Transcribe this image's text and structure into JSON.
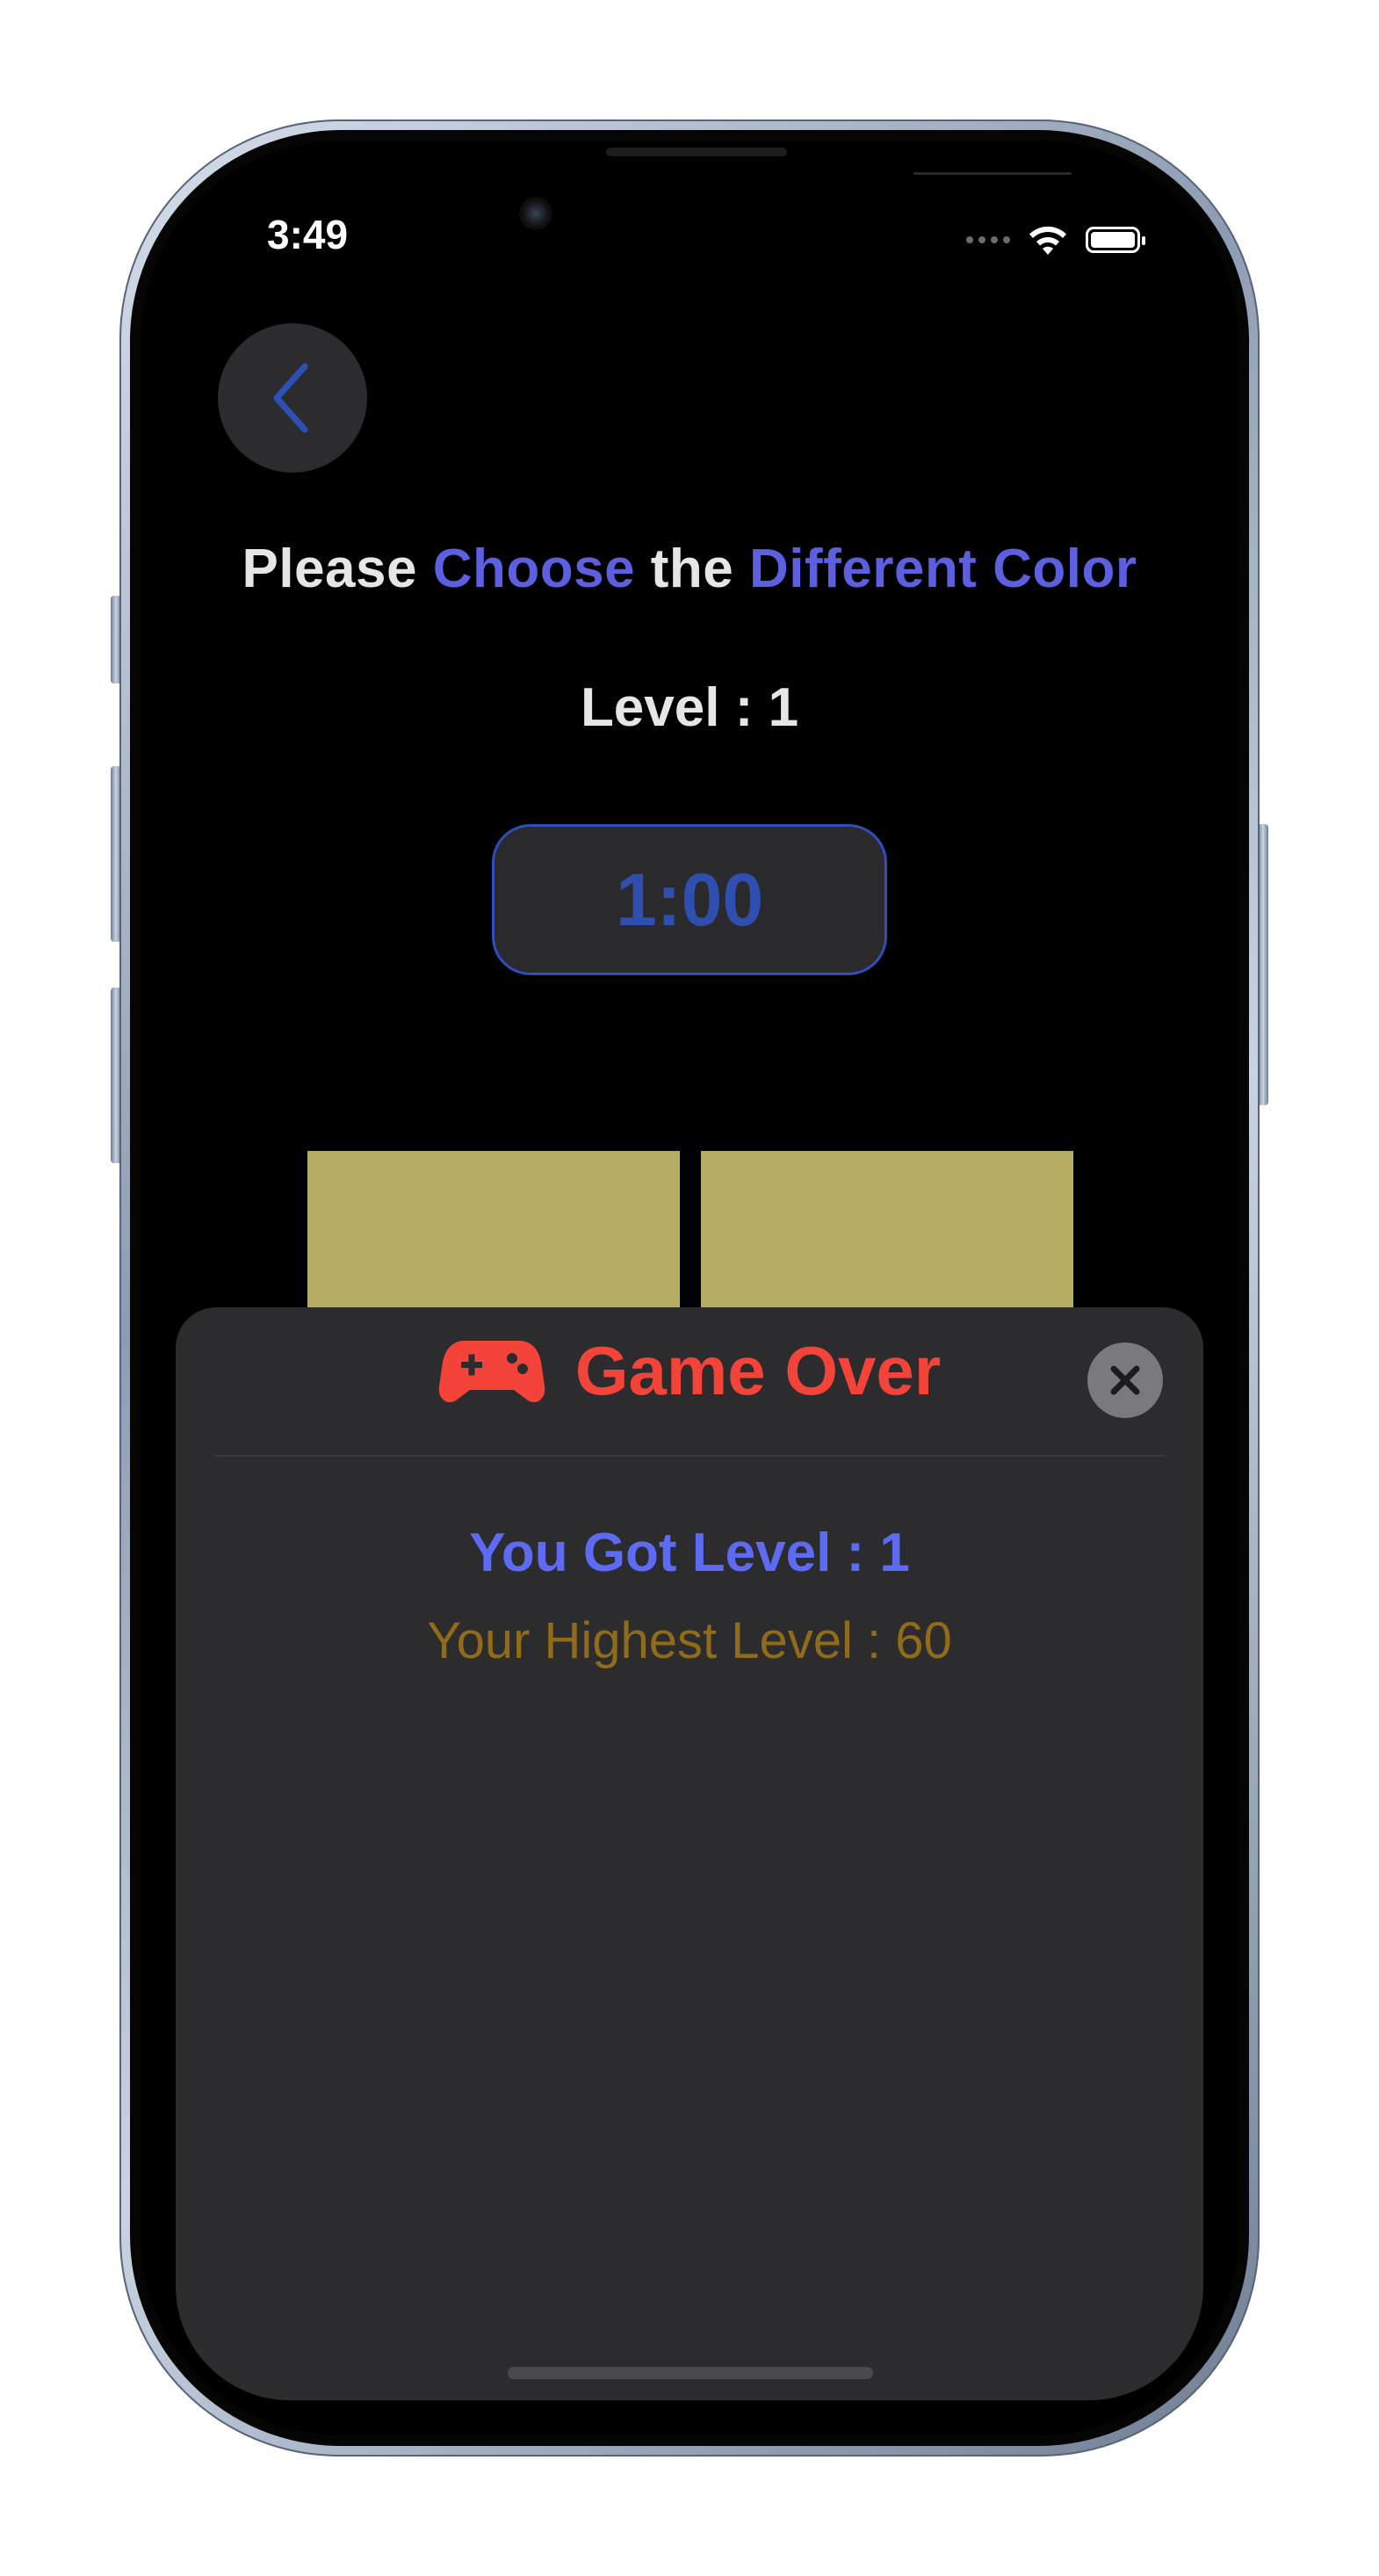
{
  "status_bar": {
    "time": "3:49",
    "wifi_icon": "wifi-icon",
    "battery_icon": "battery-icon"
  },
  "navigation": {
    "back_icon": "chevron-left-icon"
  },
  "game": {
    "title_parts": [
      "Please ",
      "Choose",
      " the ",
      "Different Color"
    ],
    "level_label": "Level : 1",
    "timer": "1:00",
    "tile_color": "#b6ac62",
    "accent_color": "#5b5fe0"
  },
  "game_over_sheet": {
    "title": "Game Over",
    "icon": "gamepad-icon",
    "close_icon": "close-icon",
    "got_level": "You Got Level : 1",
    "highest_level": "Your Highest Level : 60",
    "title_color": "#f4443a",
    "got_level_color": "#5d6af4",
    "highest_level_color": "#8f6b1a"
  }
}
